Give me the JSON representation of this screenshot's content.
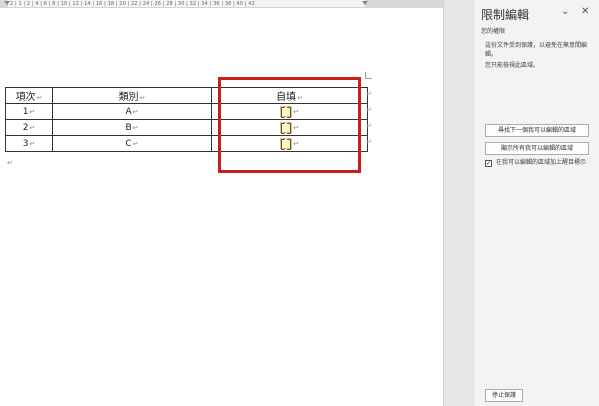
{
  "ruler": {
    "ticks": "2 | 1 | 2 | 4 | 6 | 8 | 10 | 12 | 14 | 16 | 18 | 20 | 22 | 24 | 26 | 28 | 30 | 32 | 34 | 36 | 38 | 40 | 42"
  },
  "table": {
    "headers": [
      "項次",
      "類別",
      "自填"
    ],
    "rows": [
      {
        "num": "1",
        "cat": "A"
      },
      {
        "num": "2",
        "cat": "B"
      },
      {
        "num": "3",
        "cat": "C"
      }
    ]
  },
  "pane": {
    "title": "限制編輯",
    "permissions_heading": "您的權限",
    "protection_text": "這份文件受到保護，以避免在無意間編輯。",
    "read_only_text": "您只能檢視此區域。",
    "find_next_button": "尋找下一個我可以編輯的區域",
    "show_all_button": "顯示所有我可以編輯的區域",
    "highlight_checkbox_label": "在我可以編輯的區域加上醒目標示",
    "highlight_checked": true,
    "stop_button": "停止保護"
  },
  "colors": {
    "highlight_box": "#c81d1d",
    "editable_field": "#fff5c4"
  }
}
